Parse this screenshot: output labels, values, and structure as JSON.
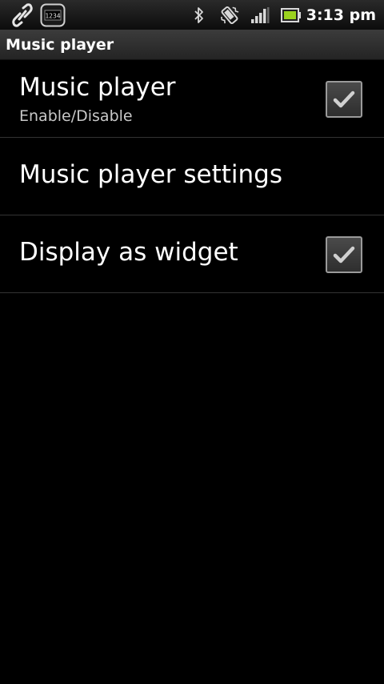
{
  "status_bar": {
    "time": "3:13 pm",
    "app_icon_text": "1234",
    "icons": [
      "link-icon",
      "app-1234-icon",
      "bluetooth-icon",
      "vibrate-icon",
      "signal-icon",
      "battery-icon"
    ]
  },
  "title_bar": {
    "title": "Music player"
  },
  "preferences": [
    {
      "title": "Music player",
      "summary": "Enable/Disable",
      "checked": true
    },
    {
      "title": "Music player settings"
    },
    {
      "title": "Display as widget",
      "checked": true
    }
  ],
  "colors": {
    "background": "#000000",
    "divider": "#333333",
    "summary_text": "#c8c8c8"
  }
}
